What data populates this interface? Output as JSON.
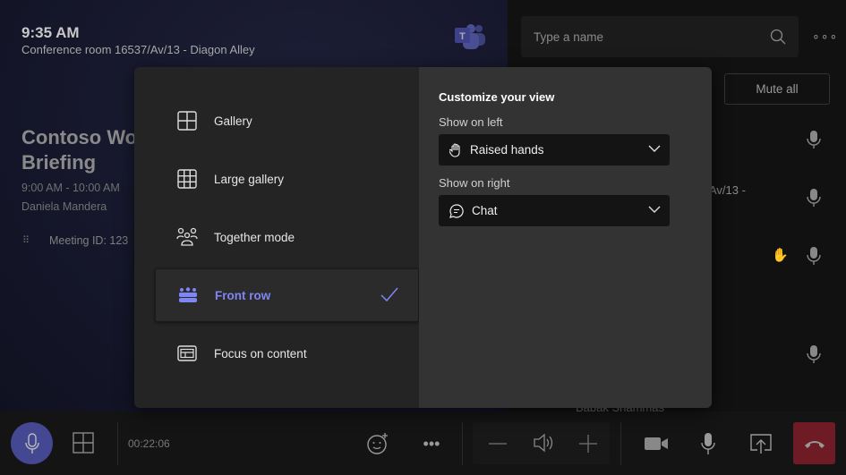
{
  "stage": {
    "time": "9:35 AM",
    "room": "Conference room 16537/Av/13 - Diagon Alley",
    "meeting_title": "Contoso Weekly Briefing",
    "meeting_title_visible": "Contoso Wo",
    "meeting_title_line2": "Briefing",
    "meeting_time": "9:00 AM - 10:00 AM",
    "organizer": "Daniela Mandera",
    "meeting_id": "Meeting ID: 123"
  },
  "participants_panel": {
    "search_placeholder": "Type a name",
    "mute_all_label": "Mute all",
    "partial_text_1": "Av/13 -",
    "partial_name_bottom": "Babak Shammas",
    "raised_hand_color": "#b8860b"
  },
  "view_menu": {
    "options": [
      {
        "label": "Gallery",
        "icon": "gallery-icon",
        "selected": false
      },
      {
        "label": "Large gallery",
        "icon": "large-gallery-icon",
        "selected": false
      },
      {
        "label": "Together mode",
        "icon": "together-mode-icon",
        "selected": false
      },
      {
        "label": "Front row",
        "icon": "front-row-icon",
        "selected": true
      },
      {
        "label": "Focus on content",
        "icon": "focus-content-icon",
        "selected": false
      }
    ],
    "accent_color": "#7f85f5"
  },
  "customize": {
    "title": "Customize your view",
    "left_label": "Show on left",
    "left_value": "Raised hands",
    "right_label": "Show on right",
    "right_value": "Chat"
  },
  "call_bar": {
    "duration": "00:22:06",
    "mic_active_color": "#444791",
    "hangup_color": "#6e1b26"
  }
}
